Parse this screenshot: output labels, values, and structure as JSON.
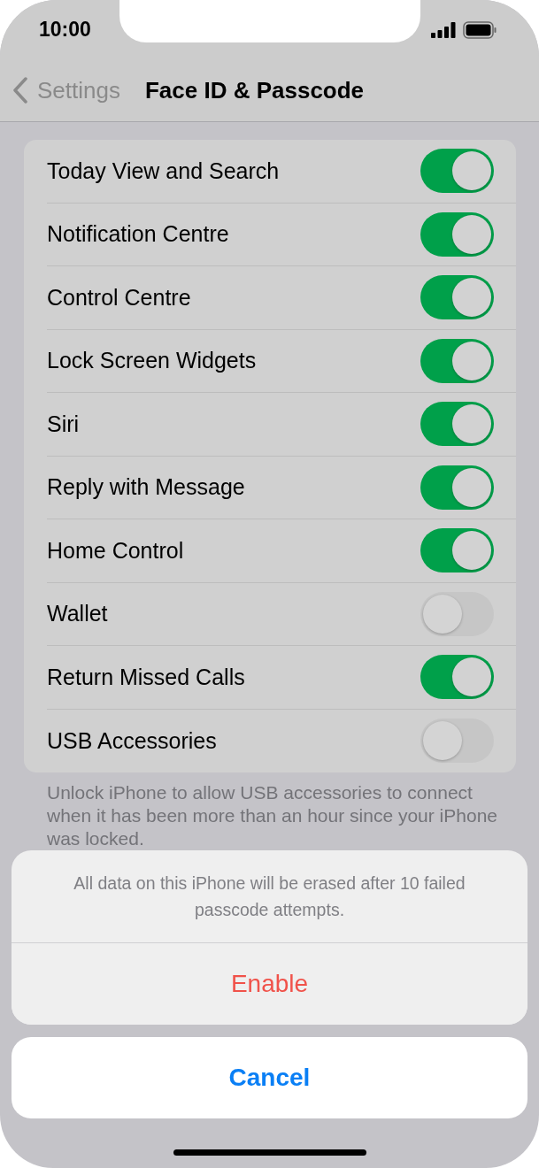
{
  "status_bar": {
    "time": "10:00"
  },
  "nav": {
    "back": "Settings",
    "title": "Face ID & Passcode"
  },
  "settings": [
    {
      "label": "Today View and Search",
      "on": true
    },
    {
      "label": "Notification Centre",
      "on": true
    },
    {
      "label": "Control Centre",
      "on": true
    },
    {
      "label": "Lock Screen Widgets",
      "on": true
    },
    {
      "label": "Siri",
      "on": true
    },
    {
      "label": "Reply with Message",
      "on": true
    },
    {
      "label": "Home Control",
      "on": true
    },
    {
      "label": "Wallet",
      "on": false
    },
    {
      "label": "Return Missed Calls",
      "on": true
    },
    {
      "label": "USB Accessories",
      "on": false
    }
  ],
  "footer": "Unlock iPhone to allow USB accessories to connect when it has been more than an hour since your iPhone was locked.",
  "action_sheet": {
    "message": "All data on this iPhone will be erased after 10 failed passcode attempts.",
    "actions": [
      {
        "label": "Enable",
        "kind": "destructive"
      }
    ],
    "cancel": "Cancel"
  }
}
